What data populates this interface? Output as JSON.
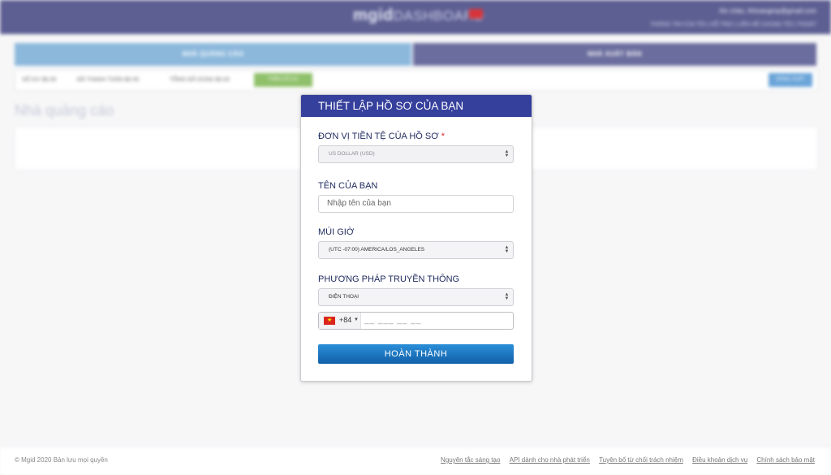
{
  "dashboard": {
    "logo_main": "mgid",
    "logo_sub": "DASHBOARD",
    "greeting": "Xin chào, thhoangmp@gmail.com",
    "top_links": "THÔNG TIN CỦA TÔI  |  HỖ TRỢ  |  LIÊN HỆ CHÚNG TÔI  |  THOÁT",
    "tab_advertiser": "NHÀ QUẢNG CÁO",
    "tab_publisher": "NHÀ XUẤT BẢN",
    "stat_balance": "SỐ DƯ  $0.00",
    "stat_paid": "ĐÃ THANH TOÁN  $0.00",
    "stat_total": "TỔNG ĐÃ DÙNG  $0.00",
    "stat_green": "THÊM SỐ DƯ",
    "stat_button": "ĐĂNG XUẤT",
    "section_title": "Nhà quảng cáo"
  },
  "modal": {
    "title": "THIẾT LẬP HỒ SƠ CỦA BẠN",
    "currency_label": "ĐƠN VỊ TIỀN TỆ CỦA HỒ SƠ",
    "required_mark": "*",
    "currency_value": "US DOLLAR (USD)",
    "name_label": "TÊN CỦA BẠN",
    "name_placeholder": "Nhập tên của bạn",
    "timezone_label": "MÚI GIỜ",
    "timezone_value": "(UTC -07:00) AMERICA/LOS_ANGELES",
    "method_label": "PHƯƠNG PHÁP TRUYỀN THÔNG",
    "method_value": "ĐIỆN THOẠI",
    "phone_code": "+84",
    "phone_placeholder": "__ ___ __ __",
    "submit_label": "HOÀN THÀNH"
  },
  "footer": {
    "copyright": "© Mgid 2020 Bản lưu mọi quyền",
    "links": [
      "Nguyên tắc sáng tạo",
      "API dành cho nhà phát triển",
      "Tuyên bố từ chối trách nhiệm",
      "Điều khoản dịch vụ",
      "Chính sách bảo mật"
    ]
  },
  "colors": {
    "header": "#5d5f92",
    "modal_header": "#353f9c",
    "submit": "#1d7bc8",
    "required": "#d9262c"
  },
  "icons": {
    "select_arrows": "up-down-chevron-icon",
    "flag": "vietnam-flag-icon",
    "dropdown_caret": "caret-down-icon"
  }
}
